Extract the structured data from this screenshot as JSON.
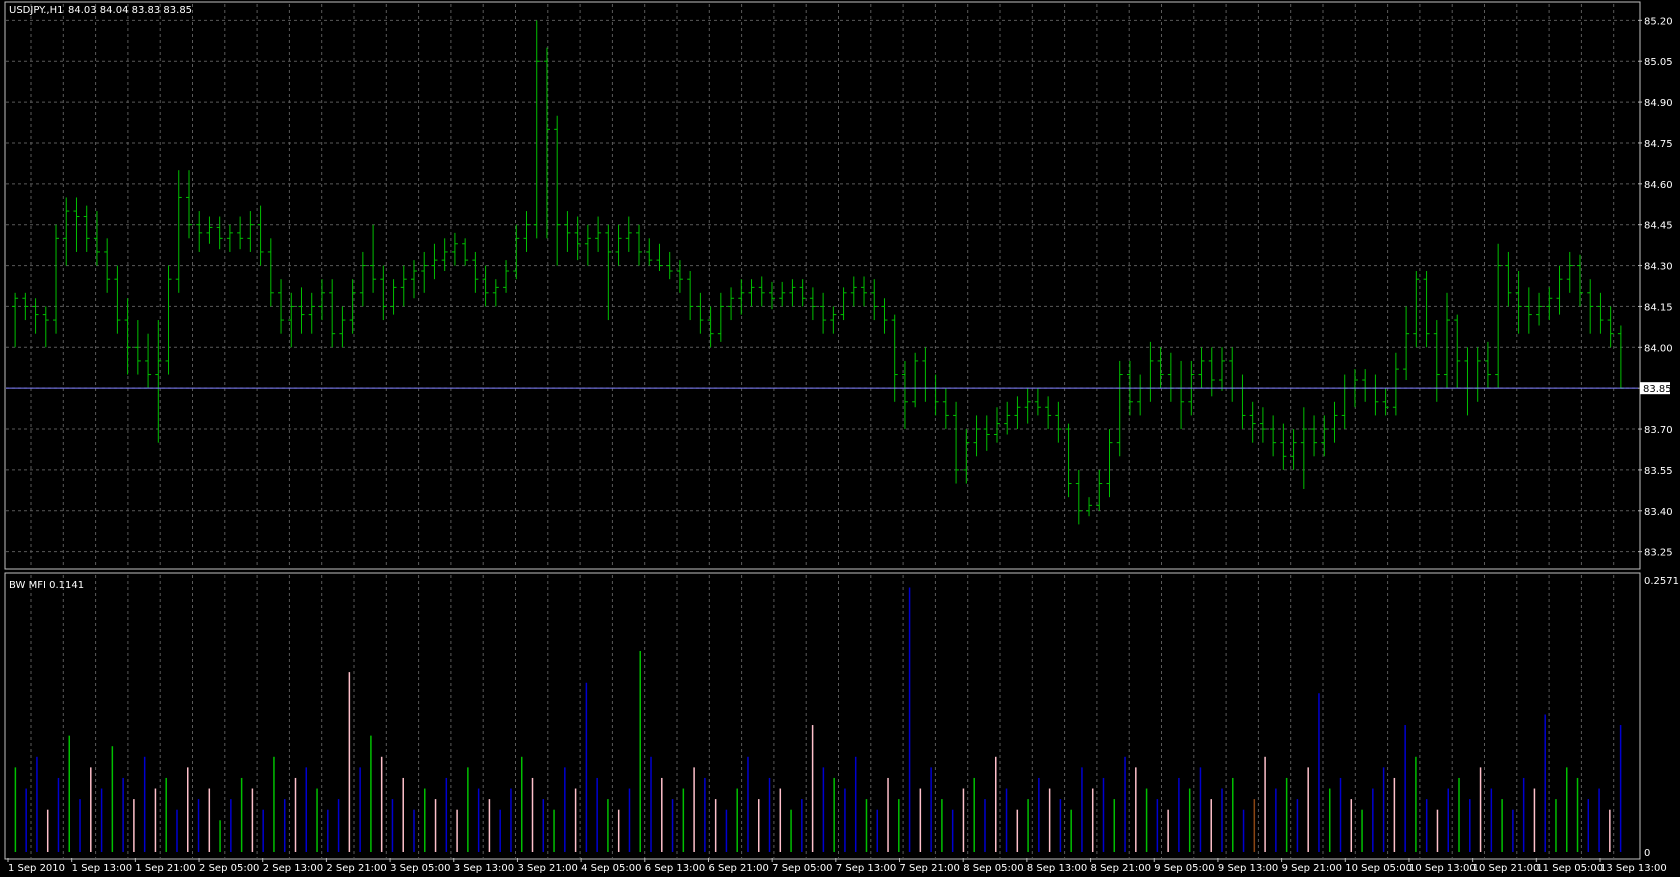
{
  "chart_data": [
    {
      "type": "ohlc",
      "title": "USDJPY.,H1",
      "ohlc_readout": "84.03 84.04 83.83 83.85",
      "ylim": [
        83.19,
        85.26
      ],
      "y_ticks": [
        "85.20",
        "85.05",
        "84.90",
        "84.75",
        "84.60",
        "84.45",
        "84.30",
        "84.15",
        "84.00",
        "83.85",
        "83.70",
        "83.55",
        "83.40",
        "83.25"
      ],
      "current_price": 83.85,
      "current_price_label": "83.85",
      "bar_color": "#00c000",
      "bars": [
        [
          84.15,
          84.2,
          84.0,
          84.18
        ],
        [
          84.18,
          84.2,
          84.1,
          84.15
        ],
        [
          84.15,
          84.18,
          84.05,
          84.12
        ],
        [
          84.12,
          84.15,
          84.0,
          84.1
        ],
        [
          84.1,
          84.45,
          84.05,
          84.4
        ],
        [
          84.4,
          84.55,
          84.3,
          84.5
        ],
        [
          84.5,
          84.55,
          84.35,
          84.48
        ],
        [
          84.48,
          84.52,
          84.35,
          84.4
        ],
        [
          84.4,
          84.5,
          84.3,
          84.35
        ],
        [
          84.35,
          84.4,
          84.2,
          84.25
        ],
        [
          84.25,
          84.3,
          84.05,
          84.1
        ],
        [
          84.1,
          84.18,
          83.9,
          84.0
        ],
        [
          84.0,
          84.1,
          83.9,
          83.95
        ],
        [
          83.95,
          84.05,
          83.85,
          83.9
        ],
        [
          83.9,
          84.1,
          83.65,
          83.95
        ],
        [
          83.95,
          84.3,
          83.9,
          84.25
        ],
        [
          84.25,
          84.65,
          84.2,
          84.55
        ],
        [
          84.55,
          84.65,
          84.4,
          84.45
        ],
        [
          84.45,
          84.5,
          84.35,
          84.42
        ],
        [
          84.42,
          84.48,
          84.38,
          84.44
        ],
        [
          84.44,
          84.48,
          84.36,
          84.4
        ],
        [
          84.4,
          84.45,
          84.35,
          84.42
        ],
        [
          84.42,
          84.48,
          84.36,
          84.4
        ],
        [
          84.4,
          84.5,
          84.35,
          84.45
        ],
        [
          84.45,
          84.52,
          84.3,
          84.35
        ],
        [
          84.35,
          84.4,
          84.15,
          84.2
        ],
        [
          84.2,
          84.25,
          84.05,
          84.1
        ],
        [
          84.1,
          84.2,
          84.0,
          84.15
        ],
        [
          84.15,
          84.22,
          84.05,
          84.12
        ],
        [
          84.12,
          84.2,
          84.05,
          84.15
        ],
        [
          84.15,
          84.25,
          84.1,
          84.2
        ],
        [
          84.2,
          84.25,
          84.0,
          84.05
        ],
        [
          84.05,
          84.15,
          84.0,
          84.1
        ],
        [
          84.1,
          84.25,
          84.05,
          84.2
        ],
        [
          84.2,
          84.35,
          84.15,
          84.3
        ],
        [
          84.3,
          84.45,
          84.2,
          84.25
        ],
        [
          84.25,
          84.3,
          84.1,
          84.15
        ],
        [
          84.15,
          84.25,
          84.12,
          84.22
        ],
        [
          84.22,
          84.3,
          84.15,
          84.25
        ],
        [
          84.25,
          84.32,
          84.18,
          84.28
        ],
        [
          84.28,
          84.35,
          84.2,
          84.3
        ],
        [
          84.3,
          84.38,
          84.25,
          84.32
        ],
        [
          84.32,
          84.4,
          84.28,
          84.35
        ],
        [
          84.35,
          84.42,
          84.3,
          84.38
        ],
        [
          84.38,
          84.4,
          84.3,
          84.32
        ],
        [
          84.32,
          84.35,
          84.2,
          84.25
        ],
        [
          84.25,
          84.3,
          84.15,
          84.2
        ],
        [
          84.2,
          84.25,
          84.15,
          84.22
        ],
        [
          84.22,
          84.32,
          84.2,
          84.28
        ],
        [
          84.28,
          84.45,
          84.25,
          84.4
        ],
        [
          84.4,
          84.5,
          84.35,
          84.45
        ],
        [
          84.45,
          85.2,
          84.4,
          85.05
        ],
        [
          85.05,
          85.1,
          84.4,
          84.8
        ],
        [
          84.8,
          84.85,
          84.3,
          84.45
        ],
        [
          84.45,
          84.5,
          84.35,
          84.42
        ],
        [
          84.42,
          84.48,
          84.32,
          84.38
        ],
        [
          84.38,
          84.45,
          84.3,
          84.4
        ],
        [
          84.4,
          84.48,
          84.35,
          84.42
        ],
        [
          84.42,
          84.45,
          84.1,
          84.35
        ],
        [
          84.35,
          84.45,
          84.3,
          84.4
        ],
        [
          84.4,
          84.48,
          84.35,
          84.42
        ],
        [
          84.42,
          84.45,
          84.3,
          84.35
        ],
        [
          84.35,
          84.4,
          84.3,
          84.32
        ],
        [
          84.32,
          84.38,
          84.28,
          84.3
        ],
        [
          84.3,
          84.35,
          84.25,
          84.28
        ],
        [
          84.28,
          84.32,
          84.2,
          84.25
        ],
        [
          84.25,
          84.28,
          84.1,
          84.15
        ],
        [
          84.15,
          84.2,
          84.05,
          84.1
        ],
        [
          84.1,
          84.15,
          84.0,
          84.05
        ],
        [
          84.05,
          84.2,
          84.02,
          84.15
        ],
        [
          84.15,
          84.22,
          84.1,
          84.18
        ],
        [
          84.18,
          84.25,
          84.12,
          84.2
        ],
        [
          84.2,
          84.25,
          84.15,
          84.22
        ],
        [
          84.22,
          84.26,
          84.15,
          84.2
        ],
        [
          84.2,
          84.24,
          84.14,
          84.18
        ],
        [
          84.18,
          84.24,
          84.15,
          84.2
        ],
        [
          84.2,
          84.25,
          84.15,
          84.22
        ],
        [
          84.22,
          84.25,
          84.15,
          84.18
        ],
        [
          84.18,
          84.22,
          84.1,
          84.15
        ],
        [
          84.15,
          84.2,
          84.05,
          84.1
        ],
        [
          84.1,
          84.15,
          84.05,
          84.12
        ],
        [
          84.12,
          84.22,
          84.1,
          84.2
        ],
        [
          84.2,
          84.26,
          84.15,
          84.22
        ],
        [
          84.22,
          84.26,
          84.15,
          84.2
        ],
        [
          84.2,
          84.25,
          84.1,
          84.15
        ],
        [
          84.15,
          84.18,
          84.05,
          84.1
        ],
        [
          84.1,
          84.12,
          83.8,
          83.9
        ],
        [
          83.9,
          83.95,
          83.7,
          83.8
        ],
        [
          83.8,
          83.98,
          83.78,
          83.95
        ],
        [
          83.95,
          84.0,
          83.8,
          83.85
        ],
        [
          83.85,
          83.9,
          83.75,
          83.8
        ],
        [
          83.8,
          83.85,
          83.7,
          83.75
        ],
        [
          83.75,
          83.8,
          83.5,
          83.55
        ],
        [
          83.55,
          83.7,
          83.5,
          83.65
        ],
        [
          83.65,
          83.75,
          83.6,
          83.7
        ],
        [
          83.7,
          83.75,
          83.62,
          83.68
        ],
        [
          83.68,
          83.78,
          83.65,
          83.72
        ],
        [
          83.72,
          83.8,
          83.68,
          83.75
        ],
        [
          83.75,
          83.82,
          83.7,
          83.78
        ],
        [
          83.78,
          83.85,
          83.72,
          83.8
        ],
        [
          83.8,
          83.85,
          83.75,
          83.78
        ],
        [
          83.78,
          83.82,
          83.7,
          83.75
        ],
        [
          83.75,
          83.8,
          83.65,
          83.7
        ],
        [
          83.7,
          83.72,
          83.45,
          83.5
        ],
        [
          83.5,
          83.55,
          83.35,
          83.4
        ],
        [
          83.4,
          83.45,
          83.38,
          83.42
        ],
        [
          83.42,
          83.55,
          83.4,
          83.5
        ],
        [
          83.5,
          83.7,
          83.45,
          83.65
        ],
        [
          83.65,
          83.95,
          83.6,
          83.9
        ],
        [
          83.9,
          83.95,
          83.75,
          83.8
        ],
        [
          83.8,
          83.9,
          83.75,
          83.85
        ],
        [
          83.85,
          84.02,
          83.8,
          83.95
        ],
        [
          83.95,
          84.0,
          83.85,
          83.9
        ],
        [
          83.9,
          83.98,
          83.8,
          83.85
        ],
        [
          83.85,
          83.95,
          83.7,
          83.8
        ],
        [
          83.8,
          83.95,
          83.75,
          83.9
        ],
        [
          83.9,
          84.0,
          83.85,
          83.95
        ],
        [
          83.95,
          84.0,
          83.82,
          83.88
        ],
        [
          83.88,
          84.0,
          83.84,
          83.95
        ],
        [
          83.95,
          84.0,
          83.8,
          83.85
        ],
        [
          83.85,
          83.9,
          83.7,
          83.75
        ],
        [
          83.75,
          83.8,
          83.65,
          83.72
        ],
        [
          83.72,
          83.78,
          83.65,
          83.7
        ],
        [
          83.7,
          83.75,
          83.6,
          83.65
        ],
        [
          83.65,
          83.72,
          83.55,
          83.6
        ],
        [
          83.6,
          83.7,
          83.55,
          83.65
        ],
        [
          83.65,
          83.78,
          83.48,
          83.7
        ],
        [
          83.7,
          83.75,
          83.6,
          83.65
        ],
        [
          83.65,
          83.75,
          83.6,
          83.7
        ],
        [
          83.7,
          83.8,
          83.65,
          83.75
        ],
        [
          83.75,
          83.9,
          83.7,
          83.85
        ],
        [
          83.85,
          83.92,
          83.78,
          83.88
        ],
        [
          83.88,
          83.92,
          83.8,
          83.85
        ],
        [
          83.85,
          83.9,
          83.75,
          83.8
        ],
        [
          83.8,
          83.85,
          83.75,
          83.78
        ],
        [
          83.78,
          83.98,
          83.75,
          83.92
        ],
        [
          83.92,
          84.15,
          83.88,
          84.05
        ],
        [
          84.05,
          84.28,
          84.0,
          84.25
        ],
        [
          84.25,
          84.28,
          84.0,
          84.05
        ],
        [
          84.05,
          84.1,
          83.8,
          83.9
        ],
        [
          83.9,
          84.2,
          83.85,
          84.1
        ],
        [
          84.1,
          84.12,
          83.85,
          83.95
        ],
        [
          83.95,
          84.0,
          83.75,
          83.85
        ],
        [
          83.85,
          84.0,
          83.8,
          83.95
        ],
        [
          83.95,
          84.02,
          83.85,
          83.9
        ],
        [
          83.9,
          84.38,
          83.85,
          84.3
        ],
        [
          84.3,
          84.35,
          84.15,
          84.2
        ],
        [
          84.2,
          84.28,
          84.05,
          84.15
        ],
        [
          84.15,
          84.22,
          84.05,
          84.12
        ],
        [
          84.12,
          84.2,
          84.08,
          84.15
        ],
        [
          84.15,
          84.22,
          84.1,
          84.18
        ],
        [
          84.18,
          84.3,
          84.12,
          84.25
        ],
        [
          84.25,
          84.35,
          84.2,
          84.3
        ],
        [
          84.3,
          84.34,
          84.15,
          84.2
        ],
        [
          84.2,
          84.25,
          84.05,
          84.15
        ],
        [
          84.15,
          84.2,
          84.05,
          84.1
        ],
        [
          84.1,
          84.15,
          84.0,
          84.05
        ],
        [
          84.05,
          84.08,
          83.85,
          83.85
        ]
      ],
      "x_labels": [
        "1 Sep 2010",
        "1 Sep 13:00",
        "1 Sep 21:00",
        "2 Sep 05:00",
        "2 Sep 13:00",
        "2 Sep 21:00",
        "3 Sep 05:00",
        "3 Sep 13:00",
        "3 Sep 21:00",
        "4 Sep 05:00",
        "6 Sep 13:00",
        "6 Sep 21:00",
        "7 Sep 05:00",
        "7 Sep 13:00",
        "7 Sep 21:00",
        "8 Sep 05:00",
        "8 Sep 13:00",
        "8 Sep 21:00",
        "9 Sep 05:00",
        "9 Sep 13:00",
        "9 Sep 21:00",
        "10 Sep 05:00",
        "10 Sep 13:00",
        "10 Sep 21:00",
        "11 Sep 05:00",
        "13 Sep 13:00"
      ]
    },
    {
      "type": "bar",
      "title": "BW MFI 0.1141",
      "ylim": [
        0,
        0.2571
      ],
      "y_ticks": [
        "0.2571",
        "0"
      ],
      "colors": {
        "green": "#00c000",
        "blue": "#0000d0",
        "brown": "#8b4513",
        "pink": "#ffc0cb"
      },
      "values": [
        0.08,
        0.06,
        0.09,
        0.04,
        0.07,
        0.11,
        0.05,
        0.08,
        0.06,
        0.1,
        0.07,
        0.05,
        0.09,
        0.06,
        0.07,
        0.04,
        0.08,
        0.05,
        0.06,
        0.03,
        0.05,
        0.07,
        0.06,
        0.04,
        0.09,
        0.05,
        0.07,
        0.08,
        0.06,
        0.04,
        0.05,
        0.17,
        0.08,
        0.11,
        0.09,
        0.05,
        0.07,
        0.04,
        0.06,
        0.05,
        0.07,
        0.04,
        0.08,
        0.06,
        0.05,
        0.04,
        0.06,
        0.09,
        0.07,
        0.05,
        0.04,
        0.08,
        0.06,
        0.16,
        0.07,
        0.05,
        0.04,
        0.06,
        0.19,
        0.09,
        0.07,
        0.05,
        0.06,
        0.08,
        0.07,
        0.05,
        0.04,
        0.06,
        0.09,
        0.05,
        0.07,
        0.06,
        0.04,
        0.05,
        0.12,
        0.08,
        0.07,
        0.06,
        0.09,
        0.05,
        0.04,
        0.07,
        0.05,
        0.25,
        0.06,
        0.08,
        0.05,
        0.04,
        0.06,
        0.07,
        0.05,
        0.09,
        0.06,
        0.04,
        0.05,
        0.07,
        0.06,
        0.05,
        0.04,
        0.08,
        0.06,
        0.07,
        0.05,
        0.09,
        0.08,
        0.06,
        0.05,
        0.04,
        0.07,
        0.06,
        0.08,
        0.05,
        0.06,
        0.07,
        0.04,
        0.05,
        0.09,
        0.06,
        0.07,
        0.05,
        0.08,
        0.15,
        0.06,
        0.07,
        0.05,
        0.04,
        0.06,
        0.08,
        0.07,
        0.12,
        0.09,
        0.05,
        0.04,
        0.06,
        0.07,
        0.05,
        0.08,
        0.06,
        0.05,
        0.04,
        0.07,
        0.06,
        0.13,
        0.05,
        0.08,
        0.07,
        0.05,
        0.06,
        0.04,
        0.12
      ],
      "color_seq": "gbbpbgbpbgbpbpgbpbpgbgpbgbpbgbbpbgpbpbgpbpgbpbbgpbgbpbbgpbgbpbgpbpbgbpbpgbpbgbbgbpgbpbgbpgbpbpgbpbgbpbgbpgbpbgbpbgbrpbgbpbgbpgbbpbgbpbgbpbgbbpbgg"
    }
  ]
}
